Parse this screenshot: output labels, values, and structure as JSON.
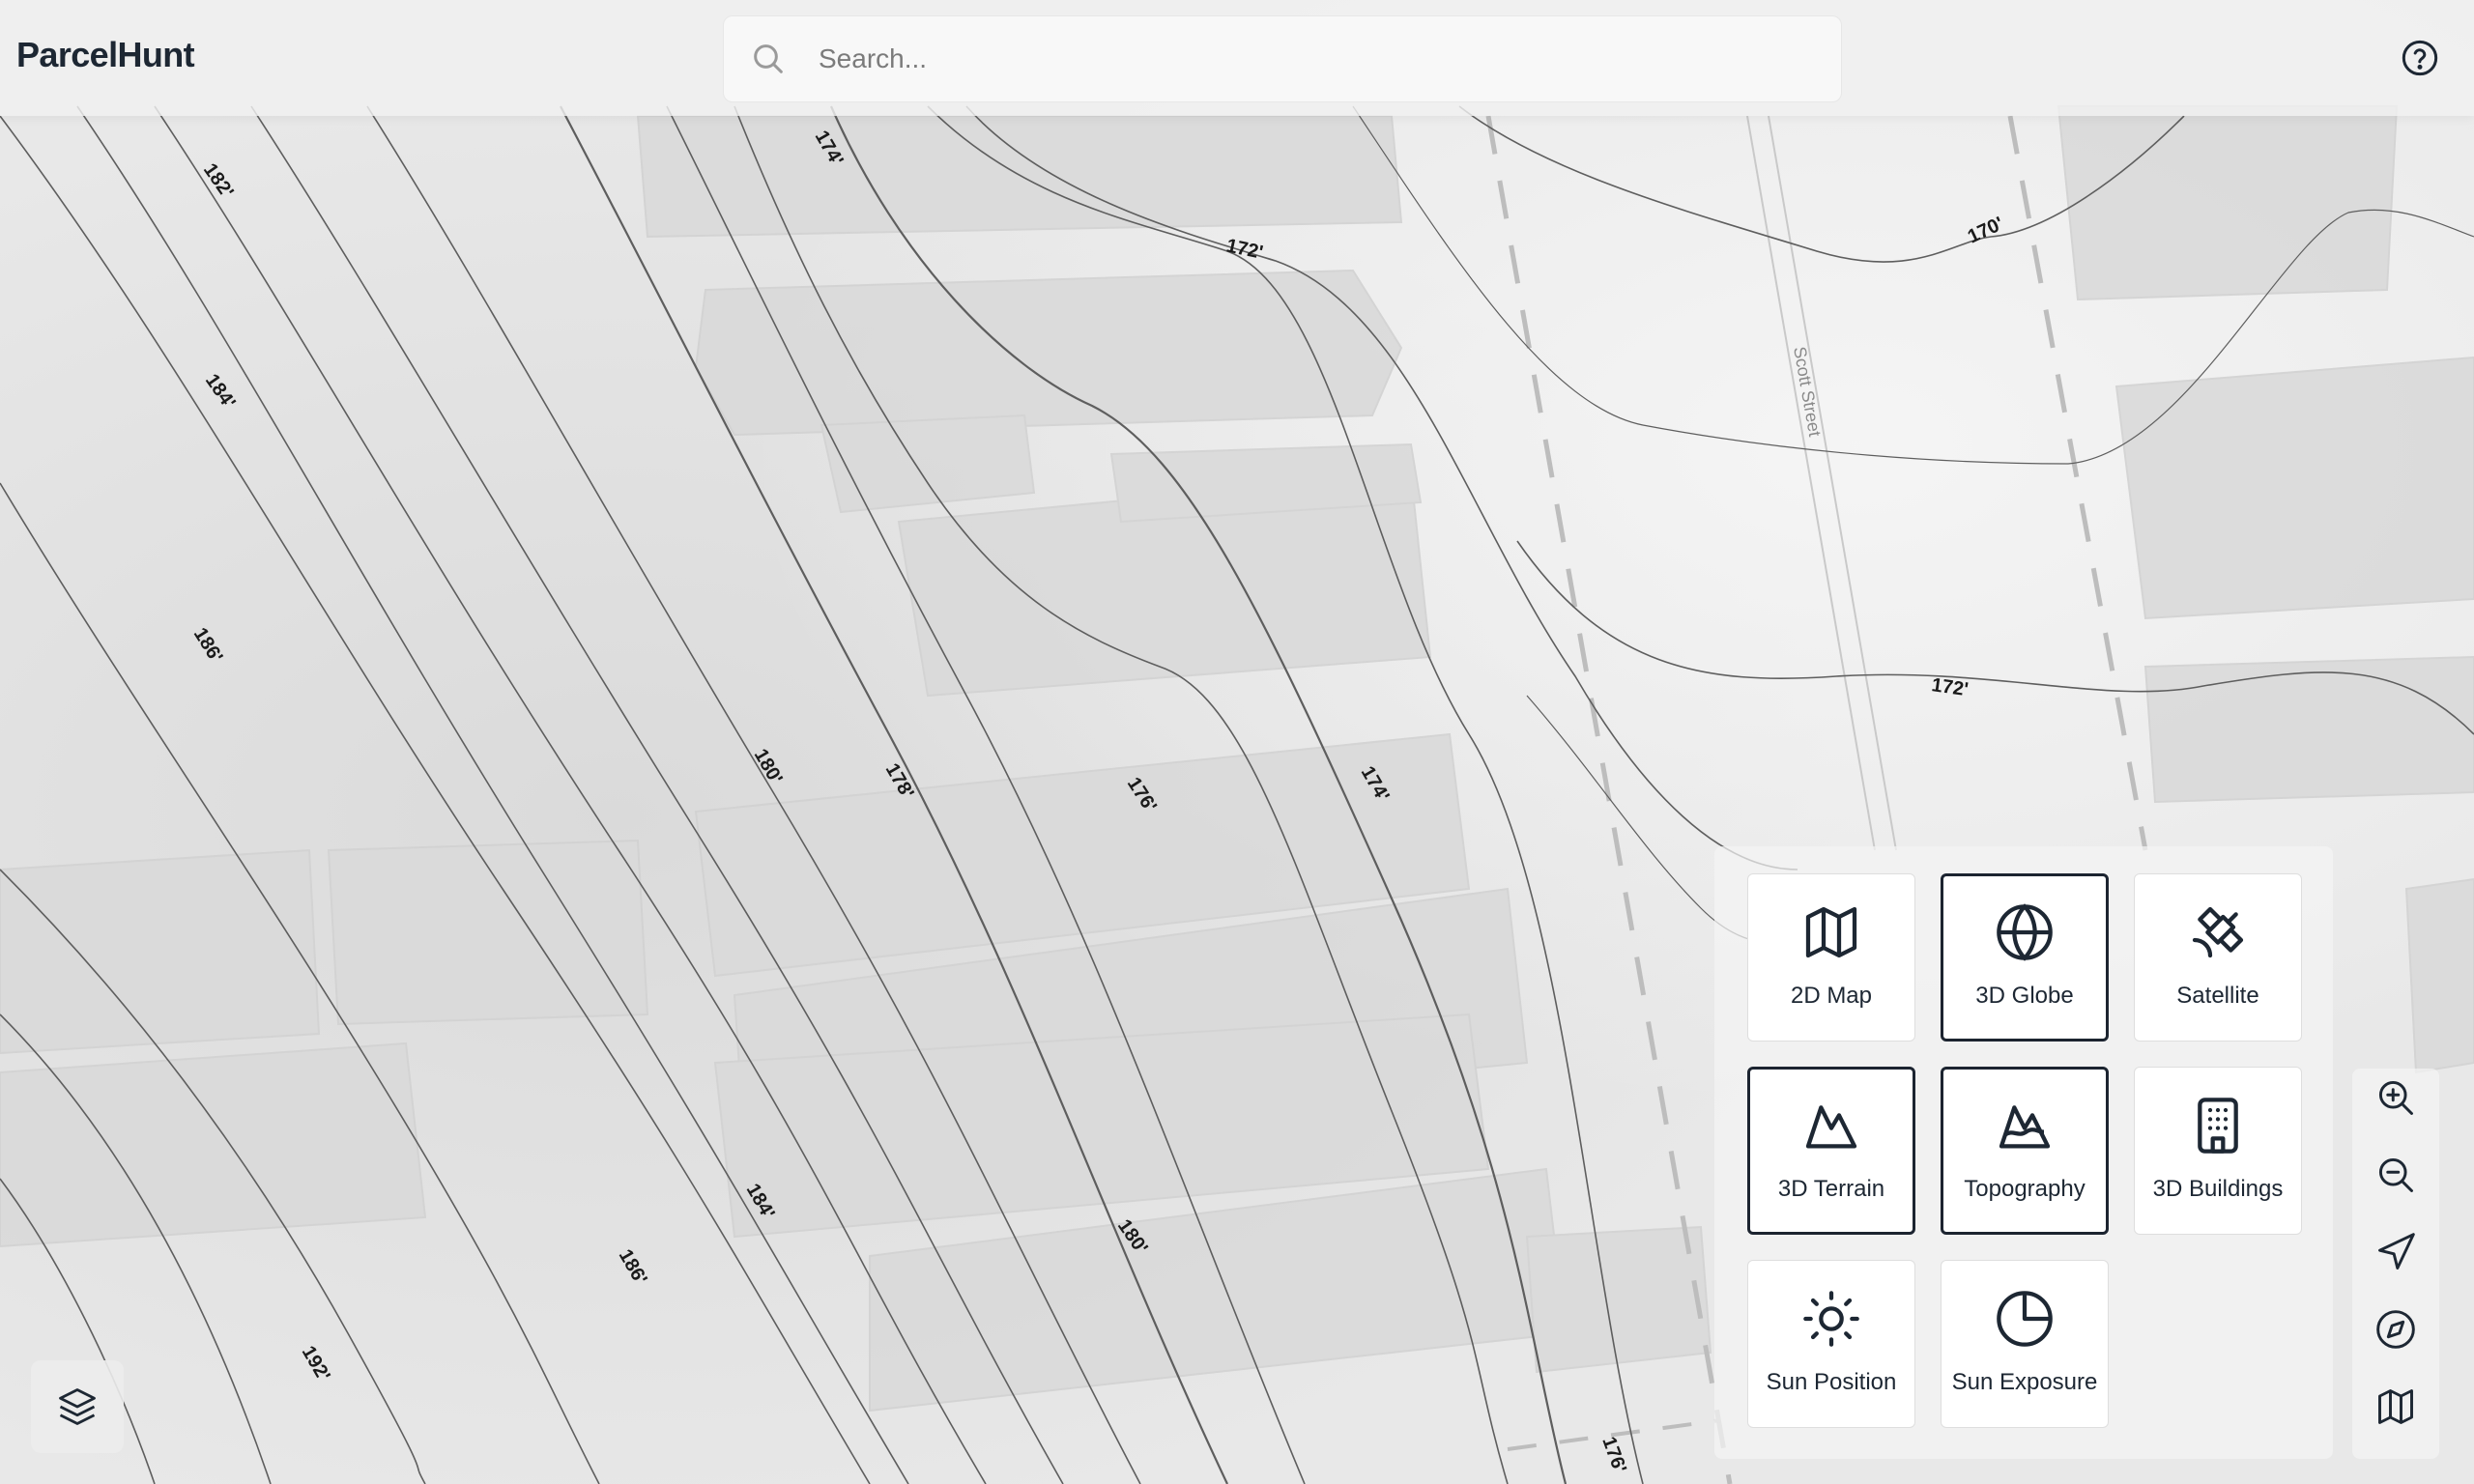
{
  "app": {
    "title": "ParcelHunt"
  },
  "search": {
    "placeholder": "Search...",
    "value": "",
    "icon": "search-icon"
  },
  "header": {
    "help_icon": "help-circle-icon"
  },
  "map": {
    "street_label": "Scott Street",
    "contour_labels": [
      "182'",
      "174'",
      "172'",
      "170'",
      "184'",
      "186'",
      "180'",
      "178'",
      "176'",
      "174'",
      "172'",
      "184'",
      "180'",
      "186'",
      "192'",
      "176'"
    ]
  },
  "view_modes": [
    {
      "label": "2D Map",
      "icon": "map-icon",
      "active": false
    },
    {
      "label": "3D Globe",
      "icon": "globe-icon",
      "active": true
    },
    {
      "label": "Satellite",
      "icon": "satellite-icon",
      "active": false
    },
    {
      "label": "3D Terrain",
      "icon": "mountain-icon",
      "active": true
    },
    {
      "label": "Topography",
      "icon": "topography-icon",
      "active": true
    },
    {
      "label": "3D Buildings",
      "icon": "building-icon",
      "active": false
    },
    {
      "label": "Sun Position",
      "icon": "sun-icon",
      "active": false
    },
    {
      "label": "Sun Exposure",
      "icon": "sun-exposure-icon",
      "active": false
    }
  ],
  "map_controls": [
    {
      "icon": "zoom-in-icon"
    },
    {
      "icon": "zoom-out-icon"
    },
    {
      "icon": "locate-icon"
    },
    {
      "icon": "compass-icon"
    },
    {
      "icon": "map-icon"
    }
  ],
  "layers_button": {
    "icon": "layers-icon"
  },
  "colors": {
    "text": "#1d2733",
    "active_border": "#1c2430",
    "map_background": "#e9e9e9",
    "contour": "#555555"
  }
}
